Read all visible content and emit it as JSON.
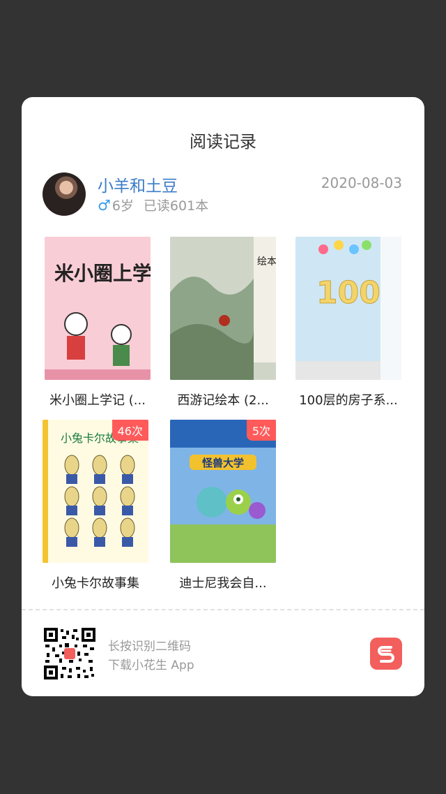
{
  "header": {
    "title": "阅读记录"
  },
  "user": {
    "name": "小羊和土豆",
    "gender_icon": "♂",
    "age": "6岁",
    "read_count": "已读601本",
    "date": "2020-08-03"
  },
  "books": [
    {
      "title": "米小圈上学记 (...",
      "cover_text": "米小圈上学记",
      "badge": ""
    },
    {
      "title": "西游记绘本 (2...",
      "cover_text": "绘本 三打白骨精",
      "badge": ""
    },
    {
      "title": "100层的房子系...",
      "cover_text": "100",
      "badge": ""
    },
    {
      "title": "小兔卡尔故事集",
      "cover_text": "小兔卡尔故事集",
      "badge": "46次"
    },
    {
      "title": "迪士尼我会自...",
      "cover_text": "怪兽大学",
      "badge": "5次"
    }
  ],
  "footer": {
    "line1": "长按识别二维码",
    "line2": "下载小花生 App"
  },
  "colors": {
    "accent": "#3a7bc8",
    "badge": "#ff5a5a",
    "logo": "#f25f5c"
  }
}
